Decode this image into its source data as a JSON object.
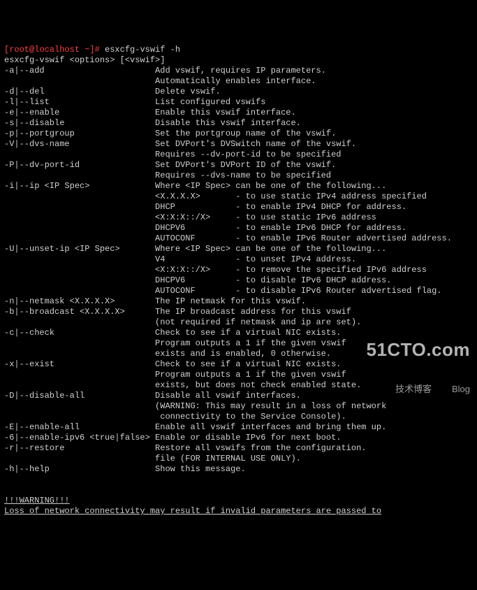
{
  "prompt": "[root@localhost ~]# ",
  "command": "esxcfg-vswif -h",
  "usage": "esxcfg-vswif <options> [<vswif>]",
  "opts": [
    {
      "flag": "-a|--add",
      "lines": [
        "Add vswif, requires IP parameters.",
        "Automatically enables interface."
      ]
    },
    {
      "flag": "-d|--del",
      "lines": [
        "Delete vswif."
      ]
    },
    {
      "flag": "-l|--list",
      "lines": [
        "List configured vswifs"
      ]
    },
    {
      "flag": "-e|--enable",
      "lines": [
        "Enable this vswif interface."
      ]
    },
    {
      "flag": "-s|--disable",
      "lines": [
        "Disable this vswif interface."
      ]
    },
    {
      "flag": "-p|--portgroup",
      "lines": [
        "Set the portgroup name of the vswif."
      ]
    },
    {
      "flag": "-V|--dvs-name",
      "lines": [
        "Set DVPort's DVSwitch name of the vswif.",
        "Requires --dv-port-id to be specified"
      ]
    },
    {
      "flag": "-P|--dv-port-id",
      "lines": [
        "Set DVPort's DVPort ID of the vswif.",
        "Requires --dvs-name to be specified"
      ]
    },
    {
      "flag": "-i|--ip <IP Spec>",
      "lines": [
        "Where <IP Spec> can be one of the following...",
        "<X.X.X.X>       - to use static IPv4 address specified",
        "DHCP            - to enable IPv4 DHCP for address.",
        "<X:X:X::/X>     - to use static IPv6 address",
        "DHCPV6          - to enable IPv6 DHCP for address.",
        "AUTOCONF        - to enable IPv6 Router advertised address."
      ]
    },
    {
      "flag": "-U|--unset-ip <IP Spec>",
      "lines": [
        "Where <IP Spec> can be one of the following...",
        "V4              - to unset IPv4 address.",
        "<X:X:X::/X>     - to remove the specified IPv6 address",
        "DHCPV6          - to disable IPv6 DHCP address.",
        "AUTOCONF        - to disable IPv6 Router advertised flag."
      ]
    },
    {
      "flag": "-n|--netmask <X.X.X.X>",
      "lines": [
        "The IP netmask for this vswif."
      ]
    },
    {
      "flag": "-b|--broadcast <X.X.X.X>",
      "lines": [
        "The IP broadcast address for this vswif",
        "(not required if netmask and ip are set)."
      ]
    },
    {
      "flag": "-c|--check",
      "lines": [
        "Check to see if a virtual NIC exists.",
        "Program outputs a 1 if the given vswif",
        "exists and is enabled, 0 otherwise."
      ]
    },
    {
      "flag": "-x|--exist",
      "lines": [
        "Check to see if a virtual NIC exists.",
        "Program outputs a 1 if the given vswif",
        "exists, but does not check enabled state."
      ]
    },
    {
      "flag": "-D|--disable-all",
      "lines": [
        "Disable all vswif interfaces.",
        "(WARNING: This may result in a loss of network",
        " connectivity to the Service Console)."
      ]
    },
    {
      "flag": "-E|--enable-all",
      "lines": [
        "Enable all vswif interfaces and bring them up."
      ]
    },
    {
      "flag": "-6|--enable-ipv6 <true|false>",
      "lines": [
        "Enable or disable IPv6 for next boot."
      ]
    },
    {
      "flag": "-r|--restore",
      "lines": [
        "Restore all vswifs from the configuration.",
        "file (FOR INTERNAL USE ONLY)."
      ]
    },
    {
      "flag": "-h|--help",
      "lines": [
        "Show this message."
      ]
    }
  ],
  "warn_hdr": "!!!WARNING!!!",
  "warn_line": "Loss of network connectivity may result if invalid parameters are passed to",
  "watermark_big": "51CTO.com",
  "watermark_sub": "技术博客        Blog"
}
